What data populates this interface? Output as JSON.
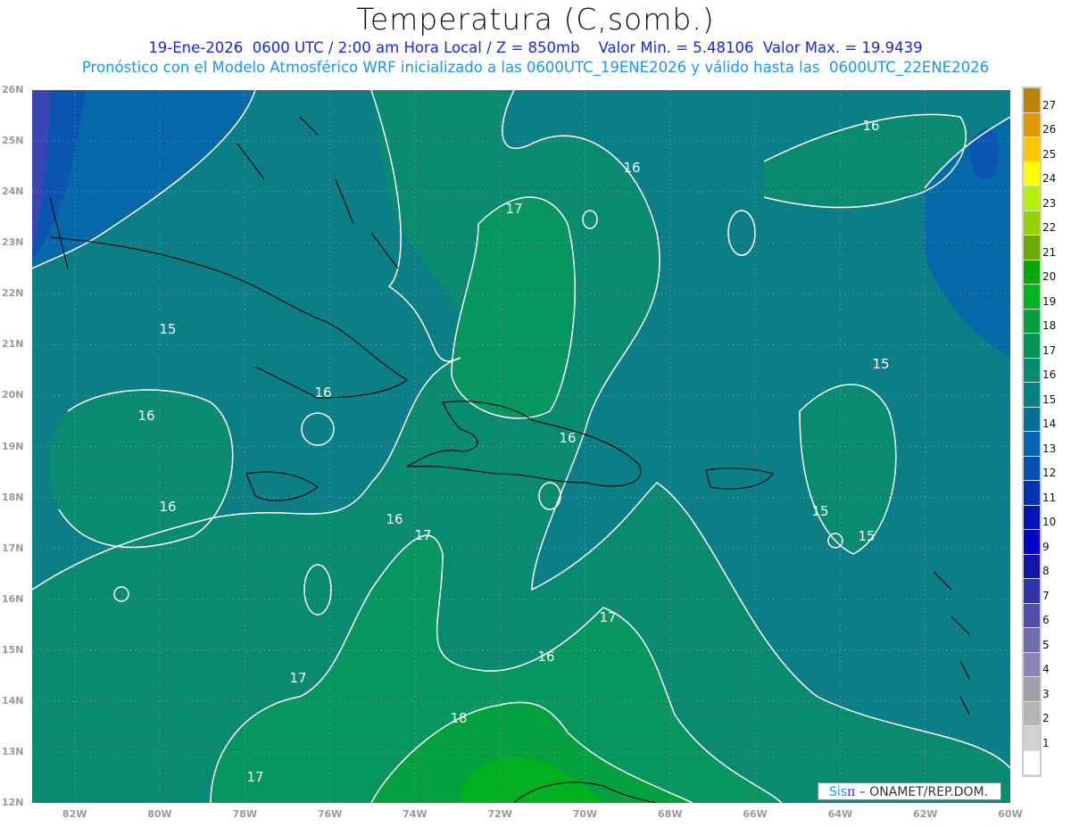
{
  "header": {
    "title": "Temperatura (C,somb.)",
    "subtitle": "19-Ene-2026  0600 UTC / 2:00 am Hora Local / Z = 850mb    Valor Min. = 5.48106  Valor Max. = 19.9439",
    "description": "Pronóstico con el Modelo Atmosférico WRF inicializado a las 0600UTC_19ENE2026 y válido hasta las  0600UTC_22ENE2026"
  },
  "map": {
    "variable": "temperature",
    "level": "850mb",
    "lat_labels": [
      "26N",
      "25N",
      "24N",
      "23N",
      "22N",
      "21N",
      "20N",
      "19N",
      "18N",
      "17N",
      "16N",
      "15N",
      "14N",
      "13N",
      "12N"
    ],
    "lon_labels": [
      "82W",
      "80W",
      "78W",
      "76W",
      "74W",
      "72W",
      "70W",
      "68W",
      "66W",
      "64W",
      "62W",
      "60W"
    ],
    "lat_range": [
      12,
      26
    ],
    "lon_range": [
      -83,
      -60
    ],
    "grid": true,
    "contour_labels": [
      "16",
      "16",
      "17",
      "15",
      "15",
      "16",
      "16",
      "16",
      "16",
      "16",
      "17",
      "16",
      "17",
      "17",
      "18",
      "17",
      "15",
      "15"
    ]
  },
  "colorbar": {
    "labels": [
      "27",
      "26",
      "25",
      "24",
      "23",
      "22",
      "21",
      "20",
      "19",
      "18",
      "17",
      "16",
      "15",
      "14",
      "13",
      "12",
      "11",
      "10",
      "9",
      "8",
      "7",
      "6",
      "5",
      "4",
      "3",
      "2",
      "1"
    ],
    "colors": [
      "#c08000",
      "#e09800",
      "#ffc800",
      "#ffff00",
      "#b4f000",
      "#96d200",
      "#6eaa00",
      "#00aa00",
      "#00b41e",
      "#00a03c",
      "#00965a",
      "#008c6e",
      "#008282",
      "#007096",
      "#0064b4",
      "#0050b4",
      "#0032b4",
      "#0014b4",
      "#0000c8",
      "#1414aa",
      "#3232aa",
      "#5050aa",
      "#6e6eaa",
      "#8c82b4",
      "#a0a0aa",
      "#b4b4b4",
      "#d2d2d2",
      "#ffffff"
    ]
  },
  "credit": {
    "logo": "Sisπ",
    "text": "– ONAMET/REP.DOM."
  }
}
